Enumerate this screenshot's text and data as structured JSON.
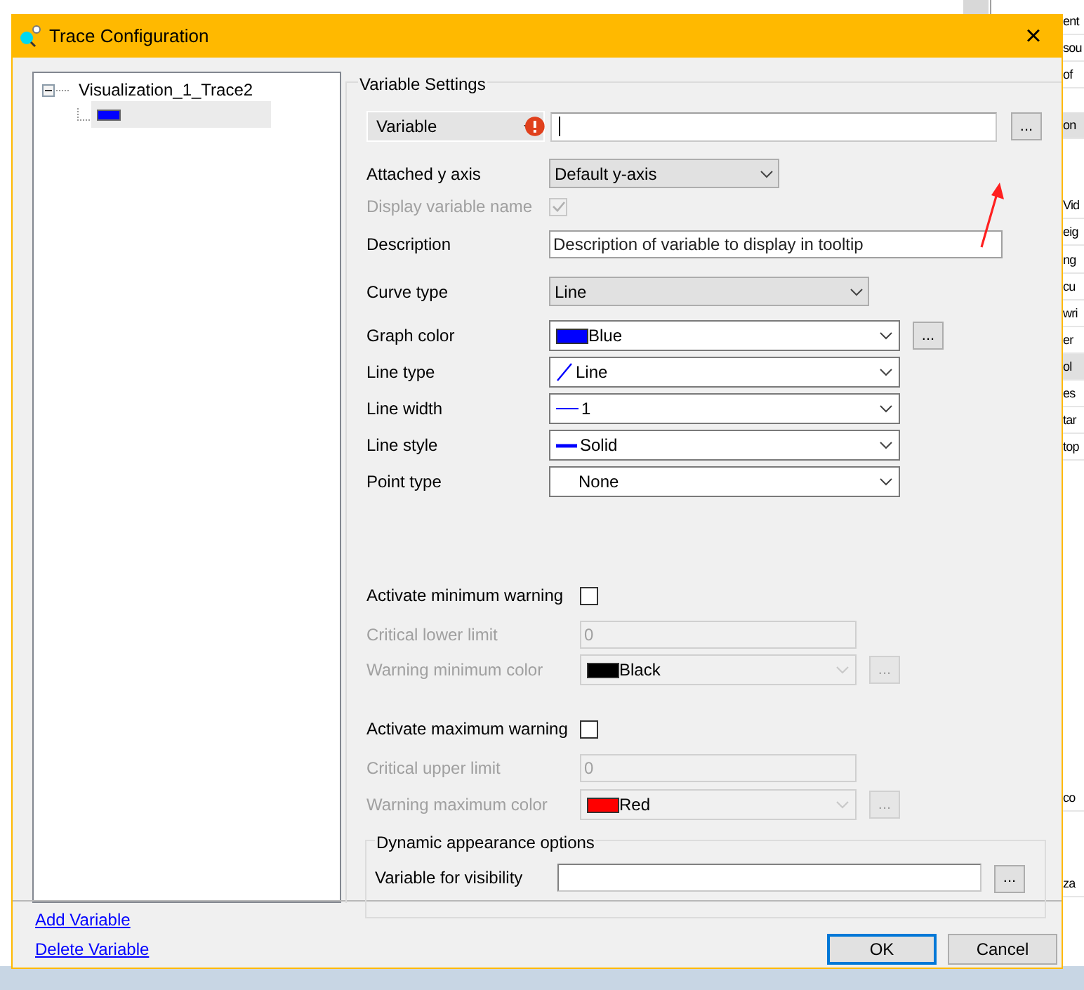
{
  "background": {
    "fragments": [
      {
        "text": "ent",
        "highlighted": false
      },
      {
        "text": "sou",
        "highlighted": false
      },
      {
        "text": "of",
        "highlighted": false
      },
      {
        "text": "on",
        "highlighted": true
      },
      {
        "text": "Vid",
        "highlighted": false
      },
      {
        "text": "eig",
        "highlighted": false
      },
      {
        "text": "ng",
        "highlighted": false
      },
      {
        "text": "cu",
        "highlighted": false
      },
      {
        "text": "wri",
        "highlighted": false
      },
      {
        "text": "er",
        "highlighted": false
      },
      {
        "text": "ol",
        "highlighted": true
      },
      {
        "text": "es",
        "highlighted": false
      },
      {
        "text": "tar",
        "highlighted": false
      },
      {
        "text": "top",
        "highlighted": false
      },
      {
        "text": "co",
        "highlighted": false
      },
      {
        "text": "za",
        "highlighted": false
      }
    ]
  },
  "window": {
    "title": "Trace Configuration",
    "close": "×"
  },
  "tree": {
    "root": {
      "label": "Visualization_1_Trace2",
      "expanded": true,
      "children": [
        {
          "color": "#0000ff",
          "selected": true
        }
      ]
    }
  },
  "variable_settings": {
    "title": "Variable Settings",
    "rows": [
      {
        "kind": "variable",
        "label": "Variable",
        "focused": true,
        "error": true,
        "button": "..."
      },
      {
        "kind": "dropdown",
        "label": "Attached y axis",
        "value": "Default y-axis",
        "disabled": false
      },
      {
        "kind": "checkbox",
        "label": "Display variable name",
        "checked": true,
        "disabled": true
      },
      {
        "kind": "textbox",
        "label": "Description",
        "value": "Description of variable to display in tooltip",
        "disabled": false
      },
      {
        "kind": "dropdown",
        "label": "Curve type",
        "value": "Line",
        "disabled": false
      },
      {
        "kind": "color",
        "label": "Graph color",
        "value": "Blue",
        "color": "#0000ff",
        "disabled": false,
        "button": "..."
      },
      {
        "kind": "style",
        "label": "Line type",
        "value": "Line",
        "icon": {
          "kind": "slash"
        },
        "disabled": false
      },
      {
        "kind": "style",
        "label": "Line width",
        "value": "1",
        "icon": {
          "kind": "thin"
        },
        "disabled": false
      },
      {
        "kind": "style",
        "label": "Line style",
        "value": "Solid",
        "icon": {
          "kind": "thick"
        },
        "disabled": false
      },
      {
        "kind": "style",
        "label": "Point type",
        "value": "None",
        "disabled": false
      },
      {
        "kind": "checkbox",
        "label": "Activate minimum warning",
        "checked": false,
        "disabled": false
      },
      {
        "kind": "textbox",
        "label": "Critical lower limit",
        "value": "0",
        "disabled": true
      },
      {
        "kind": "color",
        "label": "Warning minimum color",
        "value": "Black",
        "color": "#000000",
        "disabled": true,
        "button": "..."
      },
      {
        "kind": "checkbox",
        "label": "Activate maximum warning",
        "checked": false,
        "disabled": false
      },
      {
        "kind": "textbox",
        "label": "Critical upper limit",
        "value": "0",
        "disabled": true
      },
      {
        "kind": "color",
        "label": "Warning maximum color",
        "value": "Red",
        "color": "#ff0000",
        "disabled": true,
        "button": "..."
      }
    ]
  },
  "dynamic_appearance": {
    "title": "Dynamic appearance options",
    "label": "Variable for visibility",
    "button": "..."
  },
  "links": [
    "Add Variable",
    "Delete Variable"
  ],
  "buttons": [
    {
      "label": "OK",
      "default": true
    },
    {
      "label": "Cancel",
      "default": false
    }
  ]
}
